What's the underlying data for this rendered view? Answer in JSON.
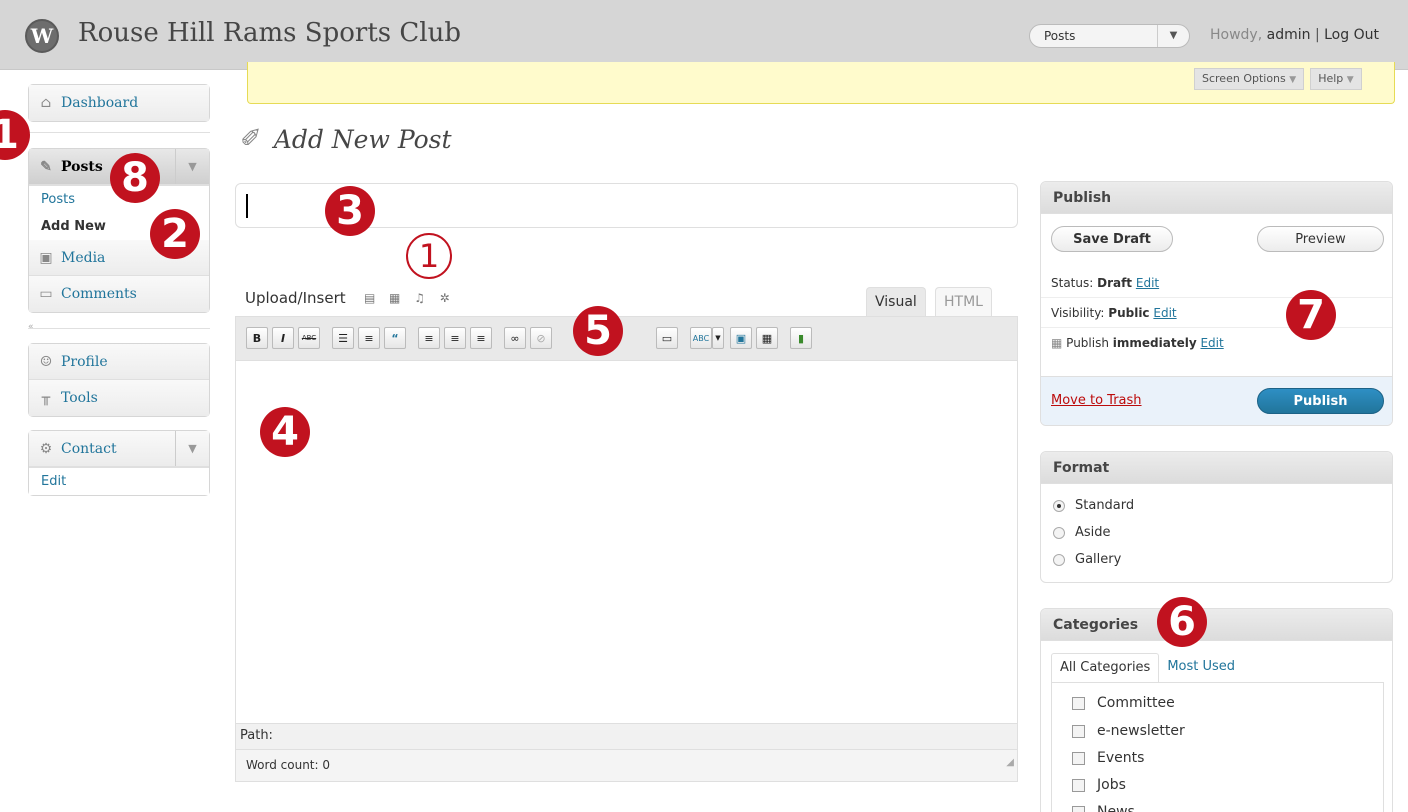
{
  "header": {
    "site_title": "Rouse Hill Rams Sports Club",
    "favorite_select": "Posts",
    "howdy_prefix": "Howdy, ",
    "username": "admin",
    "separator": " | ",
    "logout": "Log Out"
  },
  "screen_meta": {
    "screen_options": "Screen Options",
    "help": "Help"
  },
  "sidebar": {
    "dashboard": "Dashboard",
    "posts": "Posts",
    "posts_sub": [
      "Posts",
      "Add New"
    ],
    "media": "Media",
    "comments": "Comments",
    "profile": "Profile",
    "tools": "Tools",
    "contact": "Contact",
    "contact_sub": "Edit"
  },
  "main": {
    "page_title": "Add New Post",
    "upload_insert": "Upload/Insert",
    "tab_visual": "Visual",
    "tab_html": "HTML",
    "path_label": "Path:",
    "word_count": "Word count: 0"
  },
  "publish": {
    "title": "Publish",
    "save_draft": "Save Draft",
    "preview": "Preview",
    "status_label": "Status: ",
    "status_value": "Draft",
    "visibility_label": "Visibility: ",
    "visibility_value": "Public",
    "publish_label": "Publish ",
    "publish_value": "immediately",
    "edit": "Edit",
    "trash": "Move to Trash",
    "publish_button": "Publish"
  },
  "format": {
    "title": "Format",
    "options": [
      "Standard",
      "Aside",
      "Gallery"
    ],
    "selected": "Standard"
  },
  "categories": {
    "title": "Categories",
    "tab_all": "All Categories",
    "tab_most_used": "Most Used",
    "items": [
      "Committee",
      "e-newsletter",
      "Events",
      "Jobs",
      "News"
    ]
  },
  "callouts": [
    "1",
    "8",
    "2",
    "3",
    "1",
    "5",
    "4",
    "7",
    "6"
  ],
  "toolbar_buttons": [
    "B",
    "I",
    "ABC",
    "ul",
    "ol",
    "quote",
    "align-left",
    "align-center",
    "align-right",
    "link",
    "unlink",
    "more",
    "spellcheck",
    "fullscreen",
    "kitchen-sink",
    "chart"
  ]
}
